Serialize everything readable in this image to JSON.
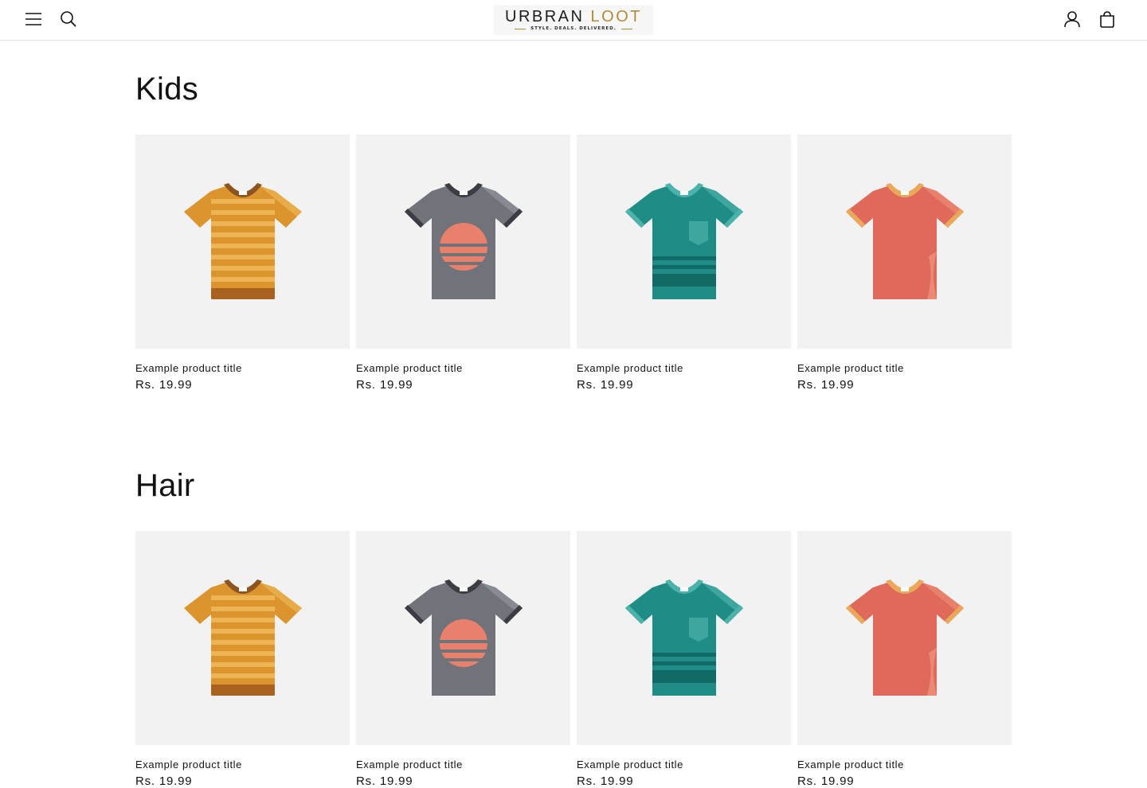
{
  "header": {
    "logo": {
      "brand_part1": "URBRAN ",
      "brand_part2": "LOOT",
      "tagline": "STYLE. DEALS. DELIVERED."
    },
    "icons": [
      "menu-icon",
      "search-icon",
      "account-icon",
      "cart-icon"
    ]
  },
  "colors": {
    "accent": "#b08a3c",
    "card_bg": "#f2f2f2",
    "text": "#121212"
  },
  "sections": [
    {
      "title": "Kids",
      "products": [
        {
          "title": "Example product title",
          "price": "Rs. 19.99",
          "variant": "orange-striped"
        },
        {
          "title": "Example product title",
          "price": "Rs. 19.99",
          "variant": "gray-sunset"
        },
        {
          "title": "Example product title",
          "price": "Rs. 19.99",
          "variant": "teal-pocket"
        },
        {
          "title": "Example product title",
          "price": "Rs. 19.99",
          "variant": "coral-plain"
        }
      ]
    },
    {
      "title": "Hair",
      "products": [
        {
          "title": "Example product title",
          "price": "Rs. 19.99",
          "variant": "orange-striped"
        },
        {
          "title": "Example product title",
          "price": "Rs. 19.99",
          "variant": "gray-sunset"
        },
        {
          "title": "Example product title",
          "price": "Rs. 19.99",
          "variant": "teal-pocket"
        },
        {
          "title": "Example product title",
          "price": "Rs. 19.99",
          "variant": "coral-plain"
        }
      ]
    }
  ]
}
